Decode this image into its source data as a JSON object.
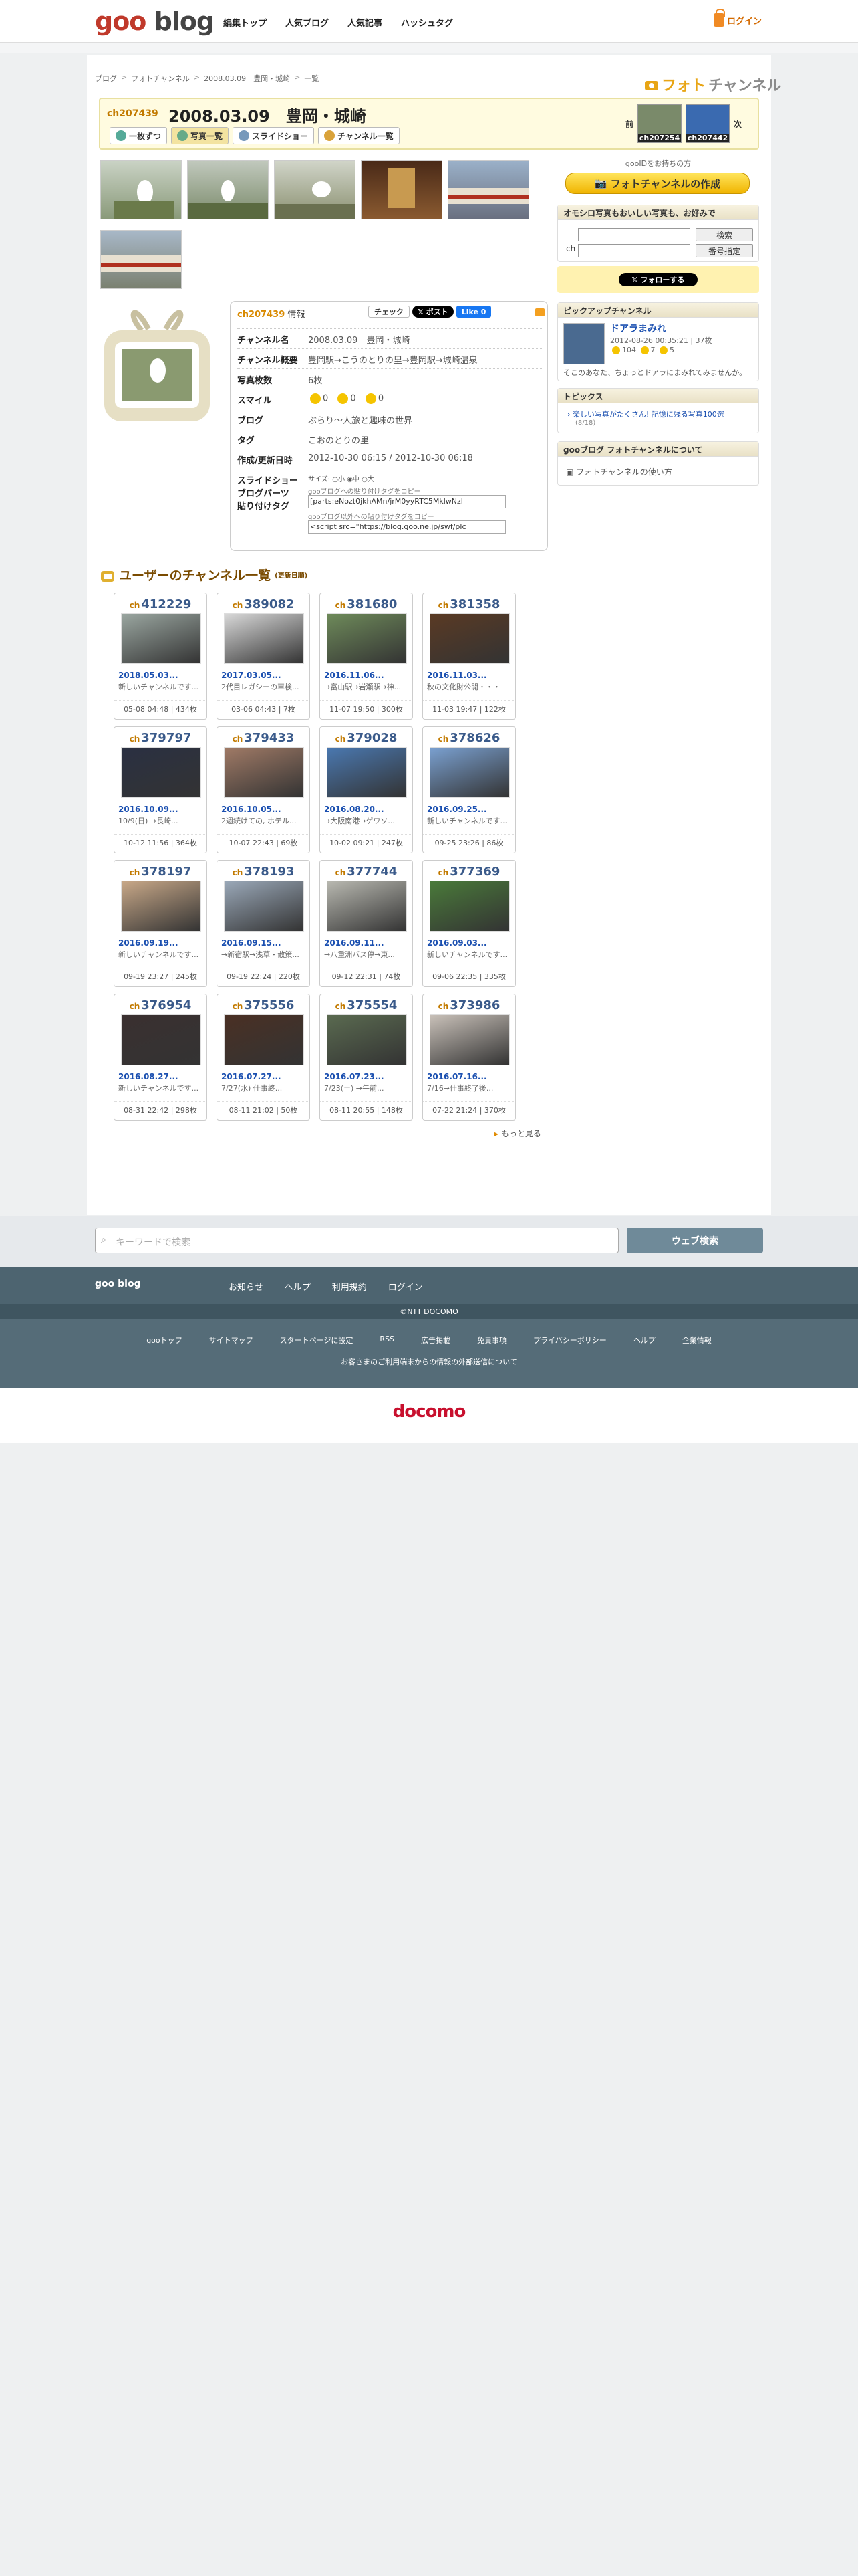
{
  "header": {
    "logo_goo": "goo",
    "logo_blog": "blog",
    "nav": [
      "編集トップ",
      "人気ブログ",
      "人気記事",
      "ハッシュタグ"
    ],
    "login": "ログイン"
  },
  "breadcrumb": [
    "ブログ",
    "フォトチャンネル",
    "2008.03.09　豊岡・城崎",
    "一覧"
  ],
  "brand": {
    "ph": "フォト",
    "ch": "チャンネル"
  },
  "channel": {
    "id": "ch207439",
    "title": "2008.03.09　豊岡・城崎"
  },
  "tabs": [
    "一枚ずつ",
    "写真一覧",
    "スライドショー",
    "チャンネル一覧"
  ],
  "prevnext": {
    "prev": "前",
    "next": "次",
    "prev_id": "ch207254",
    "next_id": "ch207442"
  },
  "info": {
    "head_id": "ch207439",
    "head_label": "情報",
    "check": "チェック",
    "post": "ポスト",
    "like": "Like 0",
    "rows": [
      {
        "k": "チャンネル名",
        "v": "2008.03.09　豊岡・城崎"
      },
      {
        "k": "チャンネル概要",
        "v": "豊岡駅→こうのとりの里→豊岡駅→城崎温泉"
      },
      {
        "k": "写真枚数",
        "v": "6枚"
      },
      {
        "k": "スマイル",
        "v": ""
      },
      {
        "k": "ブログ",
        "v": "ぶらり～人旅と趣味の世界"
      },
      {
        "k": "タグ",
        "v": "こおのとりの里"
      },
      {
        "k": "作成/更新日時",
        "v": "2012-10-30 06:15 / 2012-10-30 06:18"
      }
    ],
    "smile": [
      "0",
      "0",
      "0"
    ],
    "slide_label": "スライドショー\nブログパーツ\n貼り付けタグ",
    "size_label": "サイズ:",
    "sizes": [
      "小",
      "中",
      "大"
    ],
    "copy1": "gooブログへの貼り付けタグをコピー",
    "code1": "[parts:eNozt0jkhAMn/jrM0yyRTC5MklwNzl",
    "copy2": "gooブログ以外への貼り付けタグをコピー",
    "code2": "<script src=\"https://blog.goo.ne.jp/swf/plc"
  },
  "channels_header": {
    "title": "ユーザーのチャンネル一覧",
    "sub": "(更新日順)"
  },
  "channels": [
    {
      "ch": "412229",
      "date": "2018.05.03...",
      "desc": "新しいチャンネルです...",
      "meta": "05-08 04:48 | 434枚",
      "c": "#9aa6a0"
    },
    {
      "ch": "389082",
      "date": "2017.03.05...",
      "desc": "2代目レガシーの車検...",
      "meta": "03-06 04:43 | 7枚",
      "c": "#d8d8d8"
    },
    {
      "ch": "381680",
      "date": "2016.11.06...",
      "desc": "→富山駅→岩瀬駅→神...",
      "meta": "11-07 19:50 | 300枚",
      "c": "#6e8a5a"
    },
    {
      "ch": "381358",
      "date": "2016.11.03...",
      "desc": "秋の文化財公開・・・",
      "meta": "11-03 19:47 | 122枚",
      "c": "#5a3a24"
    },
    {
      "ch": "379797",
      "date": "2016.10.09...",
      "desc": "10/9(日) →長崎...",
      "meta": "10-12 11:56 | 364枚",
      "c": "#2a3042"
    },
    {
      "ch": "379433",
      "date": "2016.10.05...",
      "desc": "2週続けての, ホテル...",
      "meta": "10-07 22:43 | 69枚",
      "c": "#a07a66"
    },
    {
      "ch": "379028",
      "date": "2016.08.20...",
      "desc": "→大阪南港→ゲワソ...",
      "meta": "10-02 09:21 | 247枚",
      "c": "#4a78b0"
    },
    {
      "ch": "378626",
      "date": "2016.09.25...",
      "desc": "新しいチャンネルです...",
      "meta": "09-25 23:26 | 86枚",
      "c": "#7aa0d0"
    },
    {
      "ch": "378197",
      "date": "2016.09.19...",
      "desc": "新しいチャンネルです...",
      "meta": "09-19 23:27 | 245枚",
      "c": "#c8a888"
    },
    {
      "ch": "378193",
      "date": "2016.09.15...",
      "desc": "→新宿駅→浅草・散策...",
      "meta": "09-19 22:24 | 220枚",
      "c": "#9aa8b8"
    },
    {
      "ch": "377744",
      "date": "2016.09.11...",
      "desc": "→八重洲バス停→東...",
      "meta": "09-12 22:31 | 74枚",
      "c": "#b8b8b0"
    },
    {
      "ch": "377369",
      "date": "2016.09.03...",
      "desc": "新しいチャンネルです...",
      "meta": "09-06 22:35 | 335枚",
      "c": "#4a7a3a"
    },
    {
      "ch": "376954",
      "date": "2016.08.27...",
      "desc": "新しいチャンネルです...",
      "meta": "08-31 22:42 | 298枚",
      "c": "#3a3030"
    },
    {
      "ch": "375556",
      "date": "2016.07.27...",
      "desc": "7/27(水) 仕事終...",
      "meta": "08-11 21:02 | 50枚",
      "c": "#4a3024"
    },
    {
      "ch": "375554",
      "date": "2016.07.23...",
      "desc": "7/23(土) →午前...",
      "meta": "08-11 20:55 | 148枚",
      "c": "#5a6a50"
    },
    {
      "ch": "373986",
      "date": "2016.07.16...",
      "desc": "7/16→仕事終了後...",
      "meta": "07-22 21:24 | 370枚",
      "c": "#c8c0b8"
    }
  ],
  "more": "もっと見る",
  "right": {
    "gooid": "gooIDをお持ちの方",
    "create": "フォトチャンネルの作成",
    "search_head": "オモシロ写真もおいしい写真も、お好みで",
    "search_btn": "検索",
    "ch_label": "ch",
    "num_btn": "番号指定",
    "follow": "フォローする",
    "pickup_head": "ピックアップチャンネル",
    "pickup_name": "ドアラまみれ",
    "pickup_meta": "2012-08-26 00:35:21 | 37枚",
    "pickup_counts": [
      "104",
      "7",
      "5"
    ],
    "pickup_desc": "そこのあなた、ちょっとドアラにまみれてみませんか。",
    "topics_head": "トピックス",
    "topics_item": "楽しい写真がたくさん! 記憶に残る写真100選",
    "topics_date": "(8/18)",
    "about_head": "gooブログ フォトチャンネルについて",
    "about_item": "フォトチャンネルの使い方"
  },
  "footer": {
    "search_placeholder": "キーワードで検索",
    "search_btn": "ウェブ検索",
    "brand": "goo blog",
    "nav": [
      "お知らせ",
      "ヘルプ",
      "利用規約",
      "ログイン"
    ],
    "copyright": "©NTT DOCOMO",
    "nav2": [
      "gooトップ",
      "サイトマップ",
      "スタートページに設定",
      "RSS",
      "広告掲載",
      "免責事項",
      "プライバシーポリシー",
      "ヘルプ",
      "企業情報"
    ],
    "note": "お客さまのご利用端末からの情報の外部送信について",
    "docomo": "docomo"
  },
  "colors": {
    "accent": "#d98a00",
    "link": "#1a4fb0",
    "footer": "#4d6470"
  }
}
